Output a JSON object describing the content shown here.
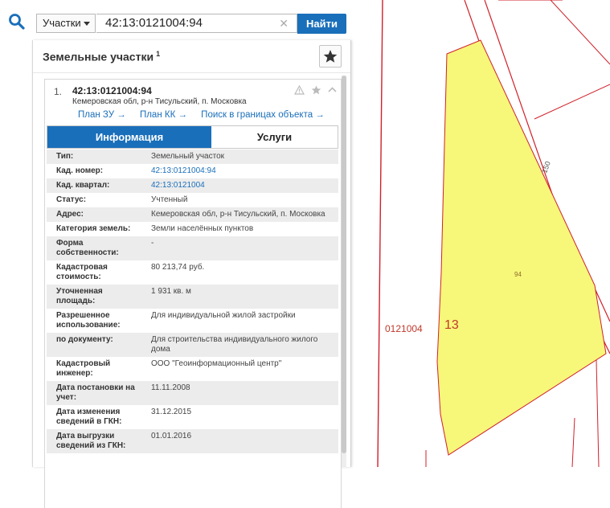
{
  "search": {
    "type_label": "Участки",
    "query": "42:13:0121004:94",
    "submit_label": "Найти"
  },
  "panel": {
    "title": "Земельные участки",
    "count": "1"
  },
  "result": {
    "index": "1.",
    "cadastral_number": "42:13:0121004:94",
    "address": "Кемеровская обл, р-н Тисульский, п. Московка",
    "links": [
      {
        "label": "План ЗУ →"
      },
      {
        "label": "План КК →"
      },
      {
        "label": "Поиск в границах объекта →"
      }
    ],
    "tabs": [
      {
        "label": "Информация",
        "active": true
      },
      {
        "label": "Услуги",
        "active": false
      }
    ],
    "fields": [
      {
        "key": "Тип:",
        "value": "Земельный участок",
        "link": false
      },
      {
        "key": "Кад. номер:",
        "value": "42:13:0121004:94",
        "link": true
      },
      {
        "key": "Кад. квартал:",
        "value": "42:13:0121004",
        "link": true
      },
      {
        "key": "Статус:",
        "value": "Учтенный",
        "link": false
      },
      {
        "key": "Адрес:",
        "value": "Кемеровская обл, р-н Тисульский, п. Московка",
        "link": false
      },
      {
        "key": "Категория земель:",
        "value": "Земли населённых пунктов",
        "link": false
      },
      {
        "key": "Форма собственности:",
        "value": "-",
        "link": false
      },
      {
        "key": "Кадастровая стоимость:",
        "value": "80 213,74 руб.",
        "link": false
      },
      {
        "key": "Уточненная площадь:",
        "value": "1 931 кв. м",
        "link": false
      },
      {
        "key": "Разрешенное использование:",
        "value": "Для индивидуальной жилой застройки",
        "link": false
      },
      {
        "key": "по документу:",
        "value": "Для строительства индивидуального жилого дома",
        "link": false
      },
      {
        "key": "Кадастровый инженер:",
        "value": "ООО \"Геоинформационный центр\"",
        "link": false
      },
      {
        "key": "Дата постановки на учет:",
        "value": "11.11.2008",
        "link": false
      },
      {
        "key": "Дата изменения сведений в ГКН:",
        "value": "31.12.2015",
        "link": false
      },
      {
        "key": "Дата выгрузки сведений из ГКН:",
        "value": "01.01.2016",
        "link": false
      }
    ]
  },
  "map": {
    "quarter_label": "0121004",
    "block_label": "13",
    "parcel_label": "94",
    "road_label": "150",
    "parcel_fill": "#f7f77a",
    "boundary_color": "#d0212a"
  },
  "colors": {
    "accent": "#1a6fba"
  },
  "icons": [
    "search-icon",
    "chevron-down-icon",
    "clear-icon",
    "star-icon",
    "warning-icon",
    "collapse-icon"
  ]
}
